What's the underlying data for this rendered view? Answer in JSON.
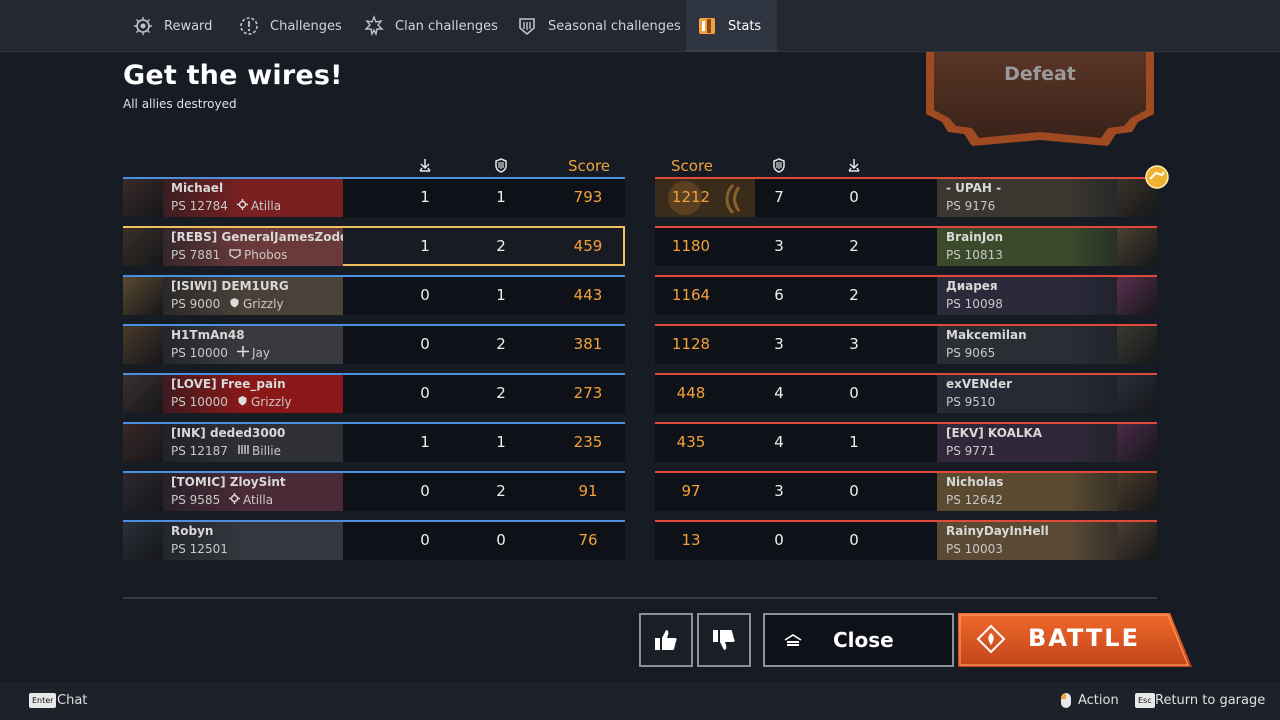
{
  "tabs": [
    {
      "label": "Reward",
      "icon": "reward-icon"
    },
    {
      "label": "Challenges",
      "icon": "challenges-icon"
    },
    {
      "label": "Clan challenges",
      "icon": "clan-challenges-icon"
    },
    {
      "label": "Seasonal challenges",
      "icon": "seasonal-challenges-icon"
    },
    {
      "label": "Stats",
      "icon": "stats-icon",
      "active": true
    }
  ],
  "header": {
    "title": "Get the wires!",
    "subtitle": "All allies destroyed",
    "result": "Defeat"
  },
  "columns": {
    "score": "Score"
  },
  "allies": [
    {
      "name": "Michael",
      "ps": "PS 12784",
      "faction": "Atilla",
      "faction_icon": "atilla-icon",
      "col1": "1",
      "col2": "1",
      "score": "793",
      "avatar": "#3a2a2a",
      "bg": "#7a2020"
    },
    {
      "name": "[REBS] GeneralJamesZodd",
      "ps": "PS 7881",
      "faction": "Phobos",
      "faction_icon": "phobos-icon",
      "col1": "1",
      "col2": "2",
      "score": "459",
      "me": true,
      "avatar": "#3a3028",
      "bg": "#6a3a3a"
    },
    {
      "name": "[ISIWI] DEM1URG",
      "ps": "PS 9000",
      "faction": "Grizzly",
      "faction_icon": "grizzly-icon",
      "col1": "0",
      "col2": "1",
      "score": "443",
      "avatar": "#5a4a30",
      "bg": "#4a4238"
    },
    {
      "name": "H1TmAn48",
      "ps": "PS 10000",
      "faction": "Jay",
      "faction_icon": "jay-icon",
      "col1": "0",
      "col2": "2",
      "score": "381",
      "avatar": "#4a3a2a",
      "bg": "#3a3a3e"
    },
    {
      "name": "[LOVE] Free_pain",
      "ps": "PS 10000",
      "faction": "Grizzly",
      "faction_icon": "grizzly-icon",
      "col1": "0",
      "col2": "2",
      "score": "273",
      "avatar": "#3a3030",
      "bg": "#8a1818"
    },
    {
      "name": "[INK] deded3000",
      "ps": "PS 12187",
      "faction": "Billie",
      "faction_icon": "billie-icon",
      "col1": "1",
      "col2": "1",
      "score": "235",
      "avatar": "#3a2828",
      "bg": "#2e3036"
    },
    {
      "name": "[TOMIC] ZloySint",
      "ps": "PS 9585",
      "faction": "Atilla",
      "faction_icon": "atilla-icon",
      "col1": "0",
      "col2": "2",
      "score": "91",
      "avatar": "#2e2830",
      "bg": "#4a2a36"
    },
    {
      "name": "Robyn",
      "ps": "PS 12501",
      "faction": "",
      "faction_icon": "",
      "col1": "0",
      "col2": "0",
      "score": "76",
      "avatar": "#2a3038",
      "bg": "#34383e"
    }
  ],
  "enemies": [
    {
      "name": "- UPAH -",
      "ps": "PS 9176",
      "score": "1212",
      "col1": "7",
      "col2": "0",
      "mvp": true,
      "avatar": "#3a3228",
      "bg": "#3a3630"
    },
    {
      "name": "BrainJon",
      "ps": "PS 10813",
      "score": "1180",
      "col1": "3",
      "col2": "2",
      "avatar": "#4a4030",
      "bg": "#3a4a2a"
    },
    {
      "name": "Диарея",
      "ps": "PS 10098",
      "score": "1164",
      "col1": "6",
      "col2": "2",
      "avatar": "#5a3050",
      "bg": "#2a2a3a"
    },
    {
      "name": "Makcemilan",
      "ps": "PS 9065",
      "score": "1128",
      "col1": "3",
      "col2": "3",
      "avatar": "#3a3a32",
      "bg": "#2a2e34"
    },
    {
      "name": "exVENder",
      "ps": "PS 9510",
      "score": "448",
      "col1": "4",
      "col2": "0",
      "avatar": "#2a2e3a",
      "bg": "#262a34"
    },
    {
      "name": "[EKV] KOALKA",
      "ps": "PS 9771",
      "score": "435",
      "col1": "4",
      "col2": "1",
      "avatar": "#4a2a4a",
      "bg": "#30283a"
    },
    {
      "name": "Nicholas",
      "ps": "PS 12642",
      "score": "97",
      "col1": "3",
      "col2": "0",
      "avatar": "#4a3a28",
      "bg": "#5a4a30"
    },
    {
      "name": "RainyDayInHell",
      "ps": "PS 10003",
      "score": "13",
      "col1": "0",
      "col2": "0",
      "avatar": "#4a3e30",
      "bg": "#5a4a34"
    }
  ],
  "buttons": {
    "close": "Close",
    "battle": "BATTLE",
    "like_icon": "thumbs-up-icon",
    "dislike_icon": "thumbs-down-icon"
  },
  "footer": {
    "chat_key": "Enter",
    "chat": "Chat",
    "action": "Action",
    "garage_key": "Esc",
    "garage": "Return to garage"
  },
  "colors": {
    "accent": "#f2a23a",
    "ally": "#4a8fe0",
    "enemy": "#e04a3a",
    "battle": "#d9501f"
  }
}
